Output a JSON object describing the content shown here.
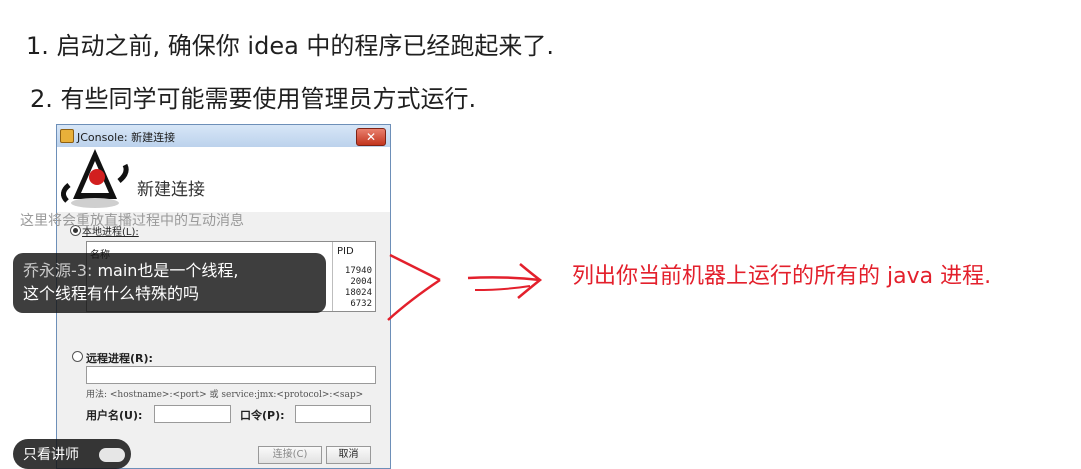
{
  "slide": {
    "line1": "1. 启动之前, 确保你 idea 中的程序已经跑起来了.",
    "line2": "2. 有些同学可能需要使用管理员方式运行.",
    "annotation": "列出你当前机器上运行的所有的 java 进程.",
    "annotation_color": "#e3202c"
  },
  "dialog": {
    "title": "JConsole: 新建连接",
    "close_glyph": "✕",
    "heading": "新建连接",
    "local_process_label": "本地进程(L):",
    "table_headers": {
      "name": "名称",
      "pid": "PID"
    },
    "processes": [
      {
        "name": "",
        "pid": "17940"
      },
      {
        "name": "",
        "pid": "2004"
      },
      {
        "name": "",
        "pid": "18024"
      },
      {
        "name": "",
        "pid": "6732"
      }
    ],
    "remote_process_label": "远程进程(R):",
    "remote_address_value": "",
    "usage_hint": "用法: <hostname>:<port> 或 service:jmx:<protocol>:<sap>",
    "username_label": "用户名(U):",
    "username_value": "",
    "password_label": "口令(P):",
    "password_value": "",
    "connect_button": "连接(C)",
    "cancel_button": "取消"
  },
  "overlay": {
    "notice": "这里将会重放直播过程中的互动消息",
    "chat_author": "乔永源-3:",
    "chat_message_part1": "main也是一个线程,",
    "chat_message_part2": "这个线程有什么特殊的吗",
    "toggle_label": "只看讲师"
  }
}
